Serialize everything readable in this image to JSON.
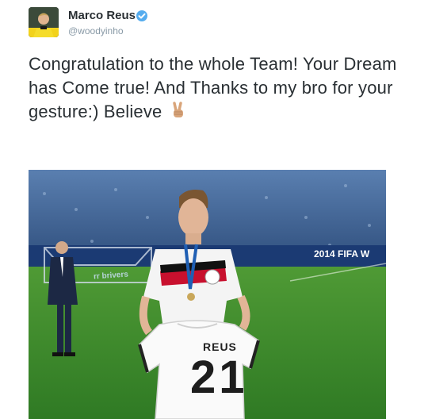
{
  "tweet": {
    "author": {
      "display_name": "Marco Reus",
      "handle": "@woodyinho",
      "verified": true,
      "avatar_icon": "player-avatar"
    },
    "text": "Congratulation to the whole Team! Your Dream has Come true! And Thanks to my bro for your gesture:) Believe",
    "emoji_icon": "victory-hand-icon",
    "media": {
      "banner_text": "2014 FIFA W",
      "board_text": "rr brivers",
      "shirt_name": "REUS",
      "shirt_number": "21"
    }
  },
  "colors": {
    "name": "#292f33",
    "handle": "#8899a6",
    "verified": "#55acee",
    "pitch": "#3a8a2c"
  }
}
